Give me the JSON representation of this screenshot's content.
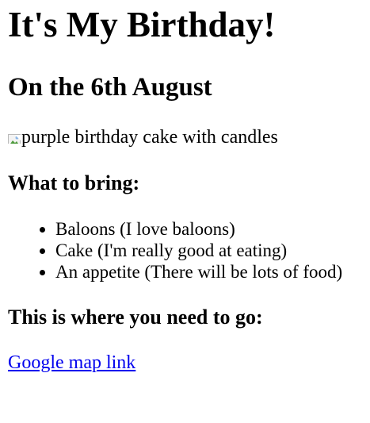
{
  "page": {
    "title": "It's My Birthday!",
    "date_heading": "On the 6th August",
    "image": {
      "alt_text": "purple birthday cake with candles",
      "icon": "broken-image-icon"
    },
    "bring_heading": "What to bring:",
    "bring_items": [
      "Baloons (I love baloons)",
      "Cake (I'm really good at eating)",
      "An appetite (There will be lots of food)"
    ],
    "go_heading": "This is where you need to go:",
    "map_link": "Google map link"
  },
  "colors": {
    "link": "#0000ee",
    "text": "#000000",
    "background": "#ffffff"
  }
}
